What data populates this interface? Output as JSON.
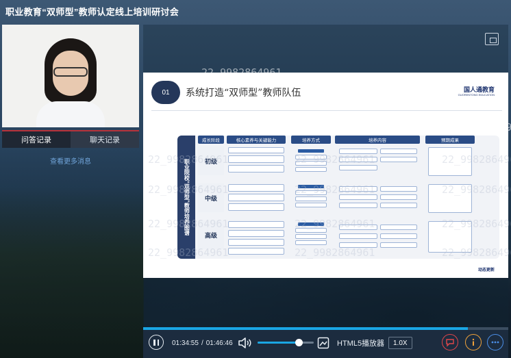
{
  "window": {
    "title": "职业教育“双师型”教师认定线上培训研讨会"
  },
  "chat": {
    "tabs": [
      {
        "label": "问答记录",
        "active": true
      },
      {
        "label": "聊天记录",
        "active": false
      }
    ],
    "more_link": "查看更多消息"
  },
  "slide": {
    "number": "01",
    "title": "系统打造“双师型”教师队伍",
    "logo": "国人通教育",
    "logo_sub": "GUORENTONG EDUCATION",
    "left_title": "职业院校“双师型”教师培养图谱",
    "columns": [
      "成长阶段",
      "核心素养与关键能力",
      "培养方式",
      "培养内容",
      "预期成果"
    ],
    "levels": [
      "初级",
      "中级",
      "高级"
    ],
    "footer_brand": "动态更新"
  },
  "watermark": {
    "text": "22_9982864961"
  },
  "player": {
    "current_time": "01:34:55",
    "separator": "/",
    "total_time": "01:46:46",
    "progress": 0.889,
    "volume": 0.74,
    "player_label": "HTML5播放器",
    "rate": "1.0X",
    "colors": {
      "accent": "#1aa6e4",
      "red": "#e0464a",
      "orange": "#f0a23a",
      "blue": "#4b8fe8"
    }
  }
}
